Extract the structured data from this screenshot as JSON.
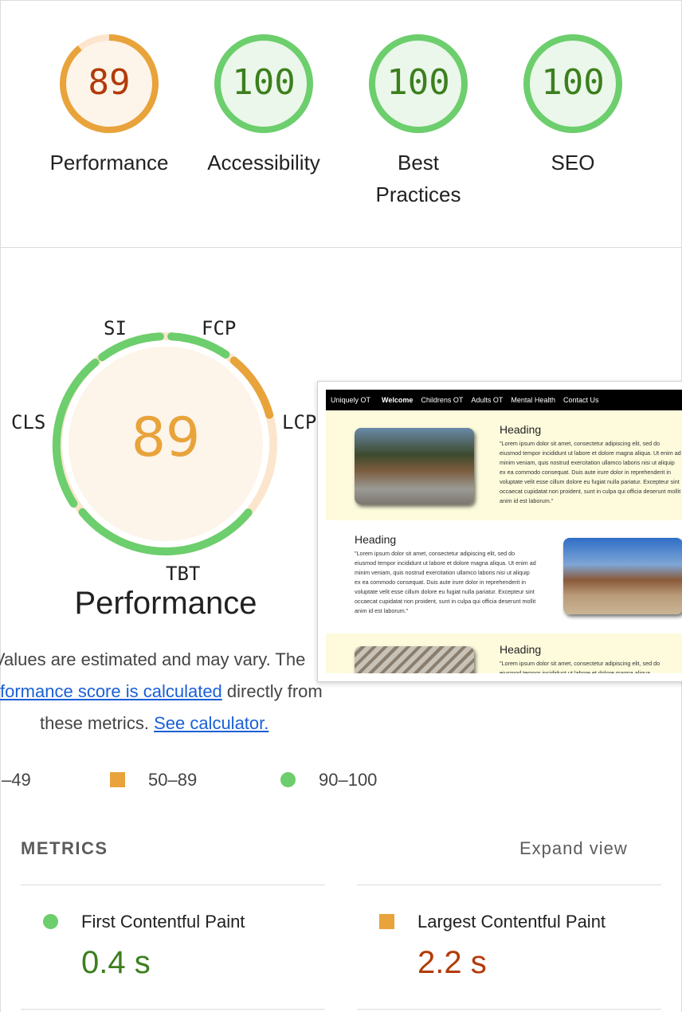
{
  "scores": [
    {
      "label": "Performance",
      "value": "89",
      "level": "average"
    },
    {
      "label": "Accessibility",
      "value": "100",
      "level": "pass"
    },
    {
      "label": "Best Practices",
      "value": "100",
      "level": "pass"
    },
    {
      "label": "SEO",
      "value": "100",
      "level": "pass"
    }
  ],
  "colors": {
    "pass_stroke": "#6cce6c",
    "pass_fill": "#eaf7ea",
    "pass_text": "#3c7f1e",
    "average_stroke": "#e8a33b",
    "average_fill": "#fdf4ea",
    "average_text": "#b23b09",
    "link": "#1a5fd6"
  },
  "performance_gauge": {
    "score": "89",
    "title": "Performance",
    "segments": {
      "si": "SI",
      "fcp": "FCP",
      "lcp": "LCP",
      "tbt": "TBT",
      "cls": "CLS"
    }
  },
  "thumbnail": {
    "nav": {
      "brand": "Uniquely OT",
      "items": [
        "Welcome",
        "Childrens OT",
        "Adults OT",
        "Mental Health",
        "Contact Us"
      ]
    },
    "heading": "Heading",
    "paragraph": "\"Lorem ipsum dolor sit amet, consectetur adipiscing elit, sed do eiusmod tempor incididunt ut labore et dolore magna aliqua. Ut enim ad minim veniam, quis nostrud exercitation ullamco laboris nisi ut aliquip ex ea commodo consequat. Duis aute irure dolor in reprehenderit in voluptate velit esse cillum dolore eu fugiat nulla pariatur. Excepteur sint occaecat cupidatat non proident, sunt in culpa qui officia deserunt mollit anim id est laborum.\"",
    "paragraph_partial": "\"Lorem ipsum dolor sit amet, consectetur adipiscing elit, sed do eiusmod tempor incididunt ut labore et dolore magna aliqua."
  },
  "explanation": {
    "line1": "Values are estimated and may vary. The",
    "line2_link": "formance score is calculated",
    "line2_rest": " directly from",
    "line3_text": "these metrics.",
    "line3_link": "See calculator."
  },
  "legend": {
    "fail": "–49",
    "average": "50–89",
    "pass": "90–100"
  },
  "metrics": {
    "title": "METRICS",
    "expand": "Expand view",
    "items": [
      {
        "label": "First Contentful Paint",
        "value": "0.4 s",
        "level": "pass"
      },
      {
        "label": "Largest Contentful Paint",
        "value": "2.2 s",
        "level": "average"
      }
    ]
  }
}
